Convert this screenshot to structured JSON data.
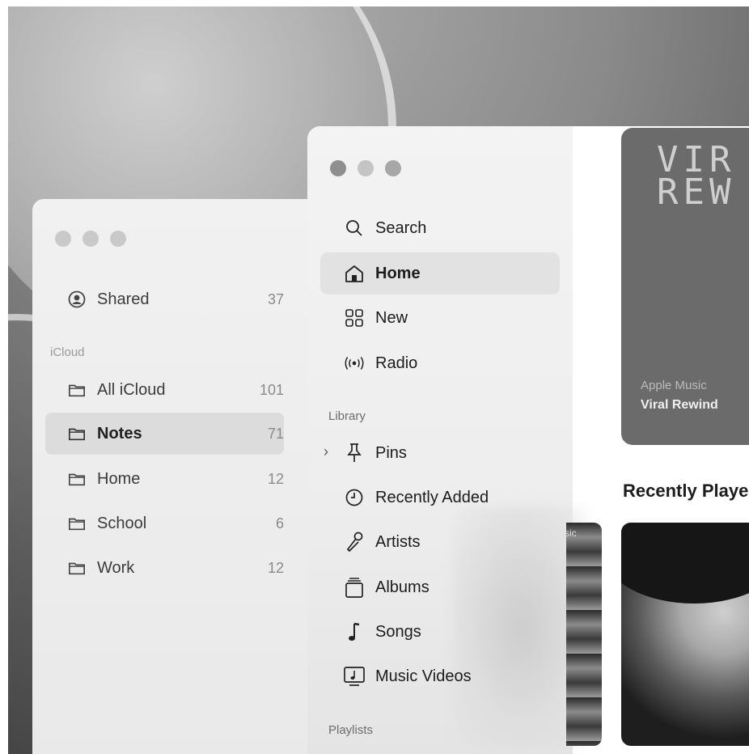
{
  "notes": {
    "shared": {
      "label": "Shared",
      "count": "37"
    },
    "section": "iCloud",
    "folders": [
      {
        "label": "All iCloud",
        "count": "101"
      },
      {
        "label": "Notes",
        "count": "71"
      },
      {
        "label": "Home",
        "count": "12"
      },
      {
        "label": "School",
        "count": "6"
      },
      {
        "label": "Work",
        "count": "12"
      }
    ]
  },
  "music": {
    "nav": [
      {
        "label": "Search",
        "icon": "search-icon"
      },
      {
        "label": "Home",
        "icon": "home-icon"
      },
      {
        "label": "New",
        "icon": "grid-icon"
      },
      {
        "label": "Radio",
        "icon": "radio-icon"
      }
    ],
    "library_title": "Library",
    "library": [
      {
        "label": "Pins",
        "icon": "pin-icon"
      },
      {
        "label": "Recently Added",
        "icon": "clock-icon"
      },
      {
        "label": "Artists",
        "icon": "microphone-icon"
      },
      {
        "label": "Albums",
        "icon": "album-icon"
      },
      {
        "label": "Songs",
        "icon": "music-note-icon"
      },
      {
        "label": "Music Videos",
        "icon": "video-icon"
      }
    ],
    "playlists_title": "Playlists",
    "hero": {
      "title": "VIR\nREW",
      "subtitle": "Apple Music",
      "name": "Viral Rewind"
    },
    "recently_played": "Recently Playe",
    "card_tag": "sic"
  }
}
